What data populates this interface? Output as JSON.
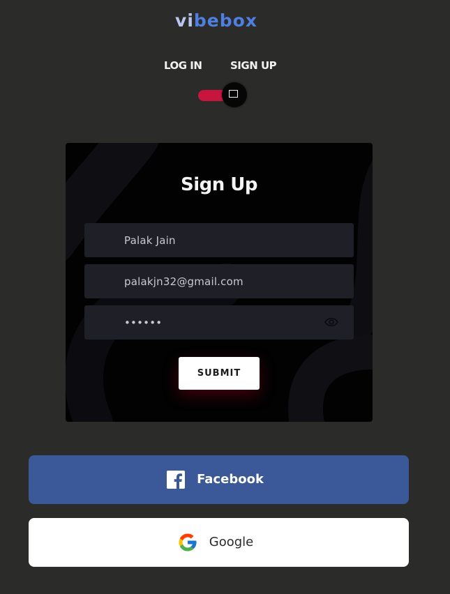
{
  "logo": {
    "part1": "vi",
    "part2": "bebox"
  },
  "mode_toggle": {
    "login_label": "LOG IN",
    "signup_label": "SIGN UP",
    "active": "SIGN UP",
    "track_color": "#c7153e",
    "knob_icon": "square-icon"
  },
  "form": {
    "title": "Sign Up",
    "name_value": "Palak Jain",
    "email_value": "palakjn32@gmail.com",
    "password_value": "••••••",
    "password_toggle_icon": "eye-icon",
    "submit_label": "SUBMIT"
  },
  "social": {
    "facebook": {
      "label": "Facebook",
      "icon": "facebook-icon",
      "color": "#3b5998"
    },
    "google": {
      "label": "Google",
      "icon": "google-icon",
      "color": "#ffffff"
    }
  }
}
